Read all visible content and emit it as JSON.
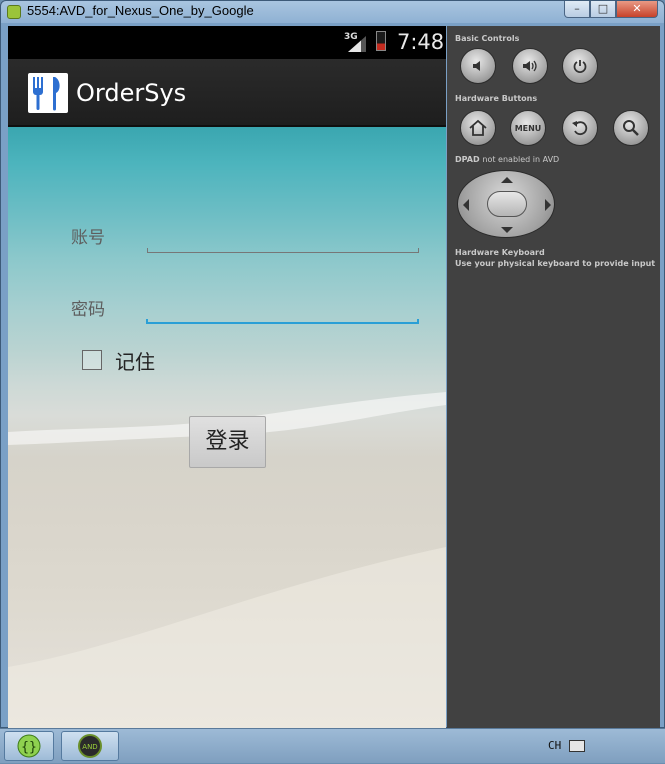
{
  "window": {
    "title": "5554:AVD_for_Nexus_One_by_Google",
    "controls": {
      "minimize": "–",
      "maximize": "□",
      "close": "✕"
    }
  },
  "statusbar": {
    "network": "3G",
    "time": "7:48"
  },
  "actionbar": {
    "title": "OrderSys",
    "icon": "fork-knife-icon"
  },
  "form": {
    "account_label": "账号",
    "account_value": "",
    "password_label": "密码",
    "password_value": "",
    "remember_label": "记住",
    "remember_checked": false,
    "login_button": "登录"
  },
  "panel": {
    "basic_controls": "Basic Controls",
    "hardware_buttons": "Hardware Buttons",
    "menu_label": "MENU",
    "dpad_title": "DPAD",
    "dpad_note": "not enabled in AVD",
    "keyboard_title": "Hardware Keyboard",
    "keyboard_note": "Use your physical keyboard to provide input"
  },
  "taskbar": {
    "lang": "CH"
  },
  "colors": {
    "accent_focus": "#2a9fd6",
    "panel_bg": "#414141",
    "actionbar_bg": "#1e1e1e"
  }
}
